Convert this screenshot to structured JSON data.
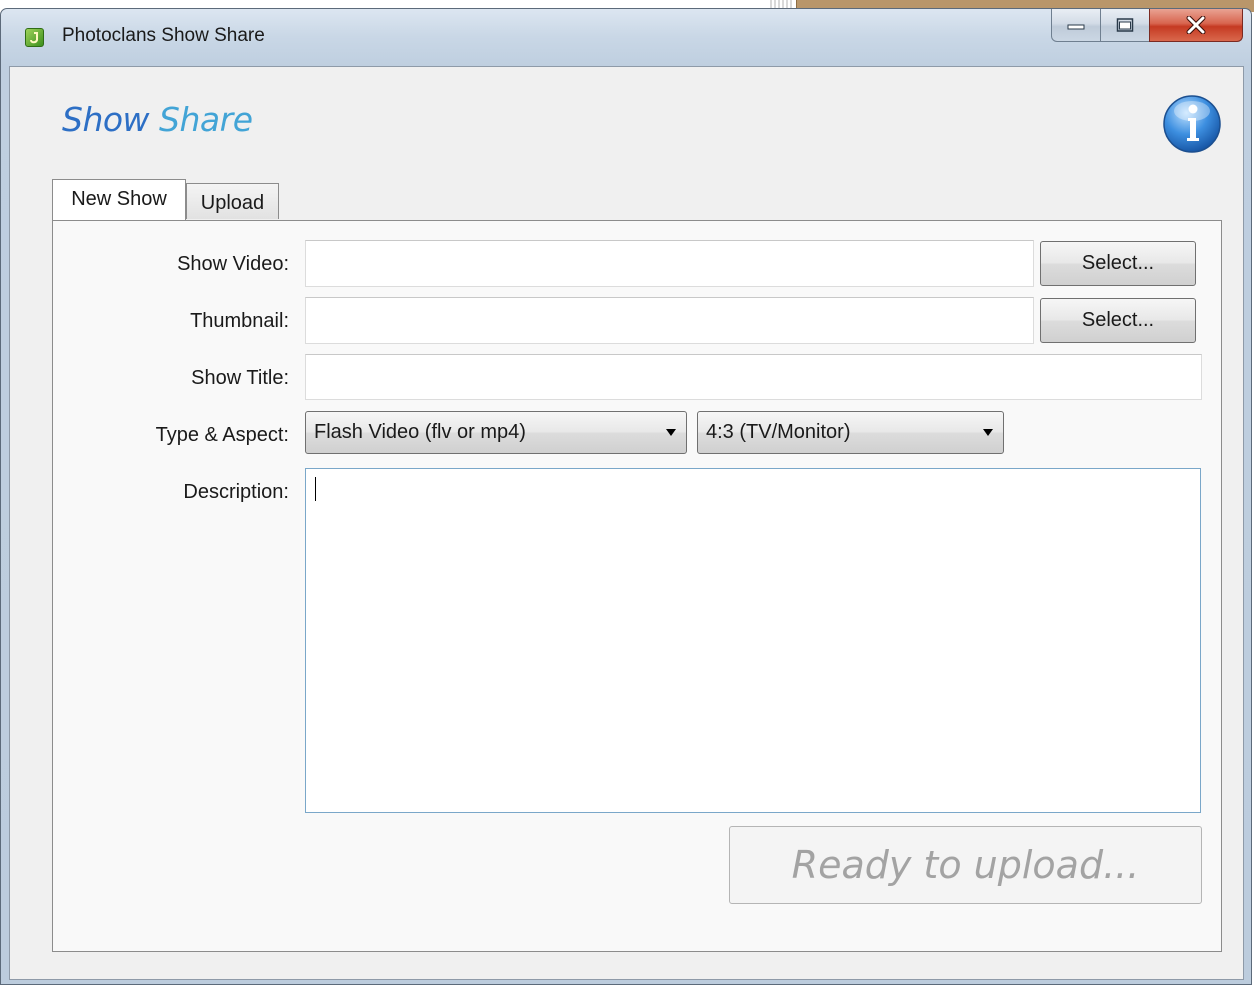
{
  "window": {
    "title": "Photoclans Show Share"
  },
  "header": {
    "title_word1": "Show",
    "title_word2": "Share"
  },
  "tabs": [
    {
      "label": "New Show",
      "active": true
    },
    {
      "label": "Upload",
      "active": false
    }
  ],
  "form": {
    "show_video": {
      "label": "Show Video:",
      "value": "",
      "button": "Select..."
    },
    "thumbnail": {
      "label": "Thumbnail:",
      "value": "",
      "button": "Select..."
    },
    "show_title": {
      "label": "Show Title:",
      "value": ""
    },
    "type_aspect": {
      "label": "Type & Aspect:",
      "type_selected": "Flash Video (flv or mp4)",
      "aspect_selected": "4:3  (TV/Monitor)"
    },
    "description": {
      "label": "Description:",
      "value": ""
    },
    "upload_button": "Ready to upload..."
  },
  "icons": {
    "app": "photoclans-app-icon",
    "info": "info-icon",
    "minimize": "minimize-icon",
    "maximize": "maximize-icon",
    "close": "close-icon",
    "dropdown": "chevron-down-icon"
  },
  "colors": {
    "title_word1": "#2d6fc5",
    "title_word2": "#42a4d6",
    "close_button": "#c53a22",
    "info_icon": "#2f7fd6"
  }
}
